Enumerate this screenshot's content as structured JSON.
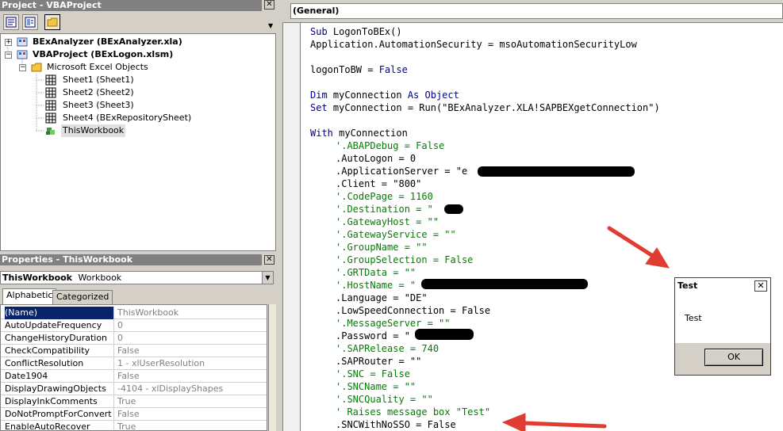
{
  "project": {
    "title": "Project - VBAProject",
    "close": "✕",
    "toolbar": [
      "view-code-icon",
      "view-object-icon",
      "toggle-folders-icon"
    ],
    "tree": {
      "item1": "BExAnalyzer (BExAnalyzer.xla)",
      "item2": "VBAProject (BExLogon.xlsm)",
      "folder": "Microsoft Excel Objects",
      "sheet1": "Sheet1 (Sheet1)",
      "sheet2": "Sheet2 (Sheet2)",
      "sheet3": "Sheet3 (Sheet3)",
      "sheet4": "Sheet4 (BExRepositorySheet)",
      "workbook": "ThisWorkbook",
      "plus": "+",
      "minus": "−"
    }
  },
  "properties": {
    "title": "Properties - ThisWorkbook",
    "close": "✕",
    "object_name": "ThisWorkbook",
    "object_type": "Workbook",
    "tab_alpha": "Alphabetic",
    "tab_cat": "Categorized",
    "rows": [
      {
        "name": "(Name)",
        "value": "ThisWorkbook"
      },
      {
        "name": "AutoUpdateFrequency",
        "value": "0"
      },
      {
        "name": "ChangeHistoryDuration",
        "value": "0"
      },
      {
        "name": "CheckCompatibility",
        "value": "False"
      },
      {
        "name": "ConflictResolution",
        "value": "1 - xlUserResolution"
      },
      {
        "name": "Date1904",
        "value": "False"
      },
      {
        "name": "DisplayDrawingObjects",
        "value": "-4104 - xlDisplayShapes"
      },
      {
        "name": "DisplayInkComments",
        "value": "True"
      },
      {
        "name": "DoNotPromptForConvert",
        "value": "False"
      },
      {
        "name": "EnableAutoRecover",
        "value": "True"
      }
    ]
  },
  "code": {
    "object_combo": "(General)",
    "lines": {
      "l0_kw": "Sub ",
      "l0": "LogonToBEx()",
      "l1": "Application.AutomationSecurity = msoAutomationSecurityLow",
      "l3": "logonToBW = ",
      "l3_kw": "False",
      "l5_kw": "Dim ",
      "l5": "myConnection ",
      "l5_kw2": "As Object",
      "l6_kw": "Set ",
      "l6": "myConnection = Run(\"BExAnalyzer.XLA!SAPBEXgetConnection\")",
      "l8_kw": "With ",
      "l8": "myConnection",
      "l9": "'.ABAPDebug = False",
      "l10": ".AutoLogon = 0",
      "l11a": ".ApplicationServer = \"e",
      "l11b": "\"",
      "l12": ".Client = \"800\"",
      "l13": "'.CodePage = 1160",
      "l14a": "'.Destination = \"",
      "l14b": "\"",
      "l15": "'.GatewayHost = \"\"",
      "l16": "'.GatewayService = \"\"",
      "l17": "'.GroupName = \"\"",
      "l18": "'.GroupSelection = False",
      "l19": "'.GRTData = \"\"",
      "l20a": "'.HostName = \"",
      "l20b": "\"",
      "l21": ".Language = \"DE\"",
      "l22": ".LowSpeedConnection = False",
      "l23": "'.MessageServer = \"\"",
      "l24a": ".Password = \"",
      "l24b": "\"",
      "l25": "'.SAPRelease = 740",
      "l26": ".SAPRouter = \"\"",
      "l27": "'.SNC = False",
      "l28": "'.SNCName = \"\"",
      "l29": "'.SNCQuality = \"\"",
      "l30": "' Raises message box \"Test\"",
      "l31": ".SNCWithNoSSO = False"
    }
  },
  "msgbox": {
    "title": "Test",
    "close": "✕",
    "message": "Test",
    "ok": "OK"
  },
  "colors": {
    "keyword": "#00008b",
    "comment": "#008000",
    "annotation_arrow": "#e03c31"
  }
}
